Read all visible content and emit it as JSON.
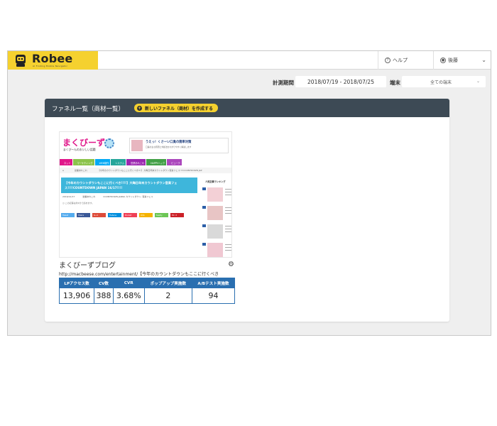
{
  "app": {
    "logo_text": "Robee",
    "logo_sub": "AI Finding Mobile Navigator"
  },
  "header": {
    "help_label": "ヘルプ",
    "user_label": "後藤"
  },
  "filters": {
    "period_label": "計測期間",
    "period_value": "2018/07/19 - 2018/07/25",
    "device_label": "端末",
    "device_value": "全ての端末"
  },
  "panel": {
    "title": "ファネル一覧（商材一覧）",
    "create_label": "新しいファネル（商材）を作成する"
  },
  "thumbnail": {
    "site_title": "まくびーず",
    "site_sub": "まくびーんのおいしい話題",
    "ad_title": "うえっ！くさーい口臭の簡単対策",
    "ad_line": "口臭の主な原因と対処法をわかりやすく解説します",
    "nav": [
      {
        "label": "ネット",
        "color": "#e0178a"
      },
      {
        "label": "マーケティング",
        "color": "#8bc34a"
      },
      {
        "label": "WEB制作",
        "color": "#03a9f4"
      },
      {
        "label": "システム",
        "color": "#26a69a"
      },
      {
        "label": "営業あれこれ",
        "color": "#9c27b0"
      },
      {
        "label": "HAPPYハック",
        "color": "#43a047"
      },
      {
        "label": "ビューテ",
        "color": "#ab47bc"
      }
    ],
    "breadcrumb": [
      "営業あれこれ",
      "【今年のカウントダウンもここに行くべき!!!】 大晦日年末カウントダウン音楽フェス!!!!COUNTDOWN JAP"
    ],
    "post_title": "【今年のカウントダウンもここに行くべき!!!!】大晦日年末カウントダウン音楽フェス!!!!COUNTDOWN JAPAN 16/17!!!!",
    "meta": [
      "2016/12/17",
      "営業あれこれ",
      "COUNTDOWN JAPAN, カウントダウン, 音楽フェス"
    ],
    "meta2": "この記事は約4分で読めます。",
    "share": [
      {
        "label": "Tweet",
        "color": "#55acee"
      },
      {
        "label": "Share",
        "color": "#3b5998"
      },
      {
        "label": "G+1",
        "color": "#dd4b39"
      },
      {
        "label": "Hatena",
        "color": "#008fde"
      },
      {
        "label": "Pocket",
        "color": "#ef4056"
      },
      {
        "label": "RSS",
        "color": "#f5b300"
      },
      {
        "label": "feedly",
        "color": "#6cc655"
      },
      {
        "label": "Pin it",
        "color": "#cb2027"
      }
    ],
    "sidebar_head": "人気記事ランキング"
  },
  "blog": {
    "name": "まくびーずブログ",
    "url": "http://macbeese.com/entertainment/【今年のカウントダウンもここに行くべき】大"
  },
  "stats": {
    "headers": [
      "LPアクセス数",
      "CV数",
      "CVR",
      "ポップアップ実施数",
      "A/Bテスト実施数"
    ],
    "values": [
      "13,906",
      "388",
      "3.68%",
      "2",
      "94"
    ]
  },
  "colors": {
    "brand_yellow": "#f5d12f",
    "panel_header": "#3d4a55",
    "table_blue": "#2a6fb0"
  }
}
